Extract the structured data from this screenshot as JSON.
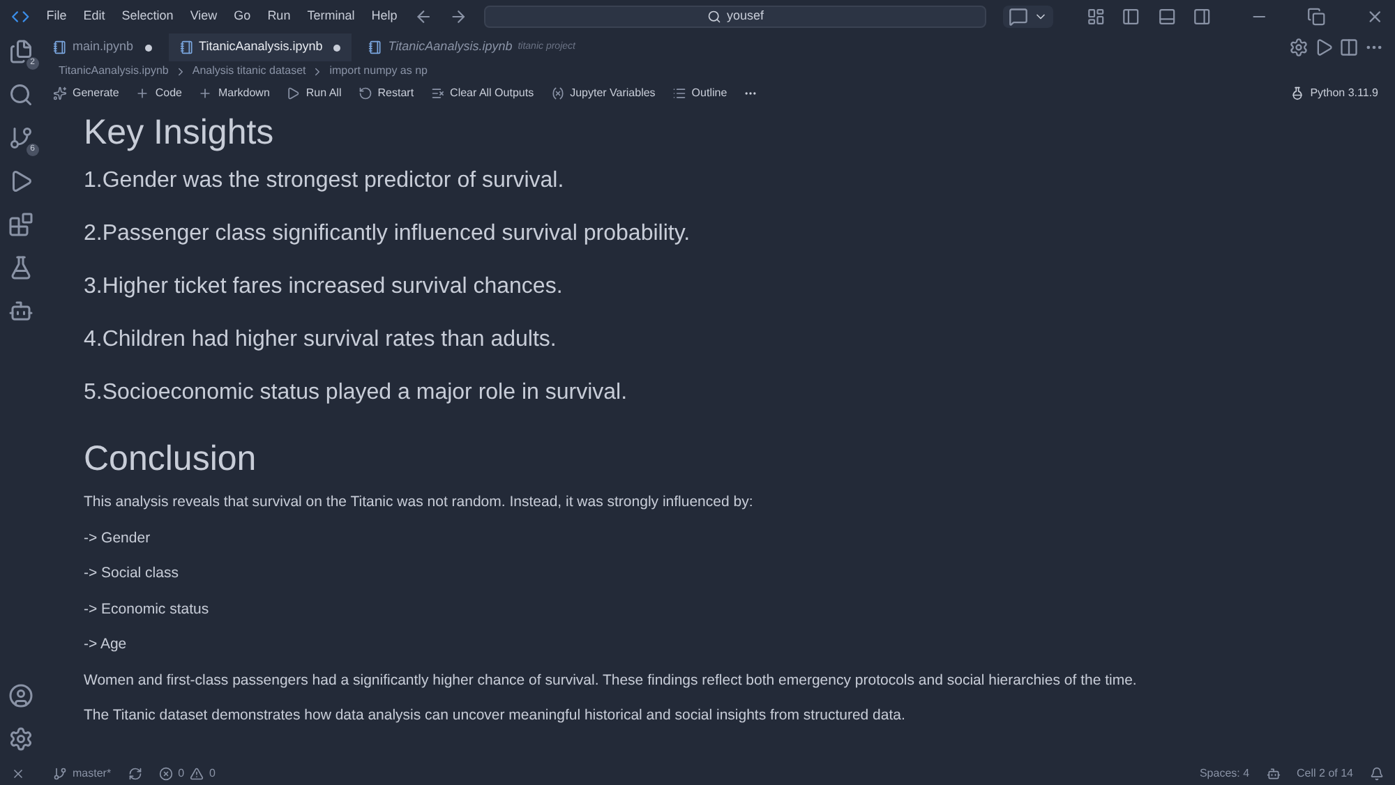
{
  "menu": [
    "File",
    "Edit",
    "Selection",
    "View",
    "Go",
    "Run",
    "Terminal",
    "Help"
  ],
  "search": {
    "value": "yousef"
  },
  "tabs": [
    {
      "label": "main.ipynb",
      "selected": false,
      "modified": true,
      "italic": false
    },
    {
      "label": "TitanicAanalysis.ipynb",
      "selected": true,
      "modified": true,
      "italic": false
    },
    {
      "label": "TitanicAanalysis.ipynb",
      "detail": "titanic project",
      "selected": false,
      "modified": false,
      "italic": true
    }
  ],
  "activity_badges": {
    "explorer": "2",
    "source_control": "6"
  },
  "breadcrumbs": [
    "TitanicAanalysis.ipynb",
    "Analysis titanic dataset",
    "import numpy as np"
  ],
  "toolbar": [
    "Generate",
    "Code",
    "Markdown",
    "Run All",
    "Restart",
    "Clear All Outputs",
    "Jupyter Variables",
    "Outline"
  ],
  "kernel": "Python 3.11.9",
  "content": [
    {
      "kind": "h1",
      "text": "Key Insights"
    },
    {
      "kind": "h2",
      "text": "1.Gender was the strongest predictor of survival."
    },
    {
      "kind": "h2",
      "text": "2.Passenger class significantly influenced survival probability."
    },
    {
      "kind": "h2",
      "text": "3.Higher ticket fares increased survival chances."
    },
    {
      "kind": "h2",
      "text": "4.Children had higher survival rates than adults."
    },
    {
      "kind": "h2",
      "text": "5.Socioeconomic status played a major role in survival."
    },
    {
      "kind": "h1",
      "text": "Conclusion"
    },
    {
      "kind": "p",
      "text": "This analysis reveals that survival on the Titanic was not random. Instead, it was strongly influenced by:"
    },
    {
      "kind": "p",
      "text": "-> Gender"
    },
    {
      "kind": "p",
      "text": "-> Social class"
    },
    {
      "kind": "p",
      "text": "-> Economic status"
    },
    {
      "kind": "p",
      "text": "-> Age"
    },
    {
      "kind": "p",
      "text": "Women and first-class passengers had a significantly higher chance of survival. These findings reflect both emergency protocols and social hierarchies of the time."
    },
    {
      "kind": "p",
      "text": "The Titanic dataset demonstrates how data analysis can uncover meaningful historical and social insights from structured data."
    }
  ],
  "status": {
    "branch": "master*",
    "errors": "0",
    "warnings": "0",
    "spaces": "Spaces: 4",
    "cell": "Cell 2 of 14"
  }
}
